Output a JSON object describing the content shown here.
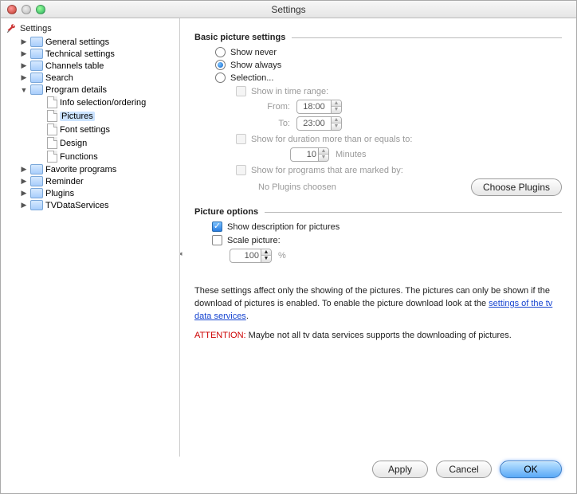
{
  "window": {
    "title": "Settings"
  },
  "sidebar": {
    "root": "Settings",
    "items": [
      {
        "label": "General settings",
        "expanded": false,
        "children": []
      },
      {
        "label": "Technical settings",
        "expanded": false,
        "children": []
      },
      {
        "label": "Channels table",
        "expanded": false,
        "children": []
      },
      {
        "label": "Search",
        "expanded": false,
        "children": []
      },
      {
        "label": "Program details",
        "expanded": true,
        "children": [
          {
            "label": "Info selection/ordering"
          },
          {
            "label": "Pictures",
            "selected": true
          },
          {
            "label": "Font settings"
          },
          {
            "label": "Design"
          },
          {
            "label": "Functions"
          }
        ]
      },
      {
        "label": "Favorite programs",
        "expanded": false,
        "children": []
      },
      {
        "label": "Reminder",
        "expanded": false,
        "children": []
      },
      {
        "label": "Plugins",
        "expanded": false,
        "children": []
      },
      {
        "label": "TVDataServices",
        "expanded": false,
        "children": []
      }
    ]
  },
  "sections": {
    "basic": {
      "heading": "Basic picture settings",
      "radios": {
        "never": "Show never",
        "always": "Show always",
        "selection": "Selection...",
        "selected": "always"
      },
      "timerange": {
        "label": "Show in time range:",
        "from_label": "From:",
        "from_value": "18:00",
        "to_label": "To:",
        "to_value": "23:00"
      },
      "duration": {
        "label": "Show for duration more than or equals to:",
        "value": "10",
        "unit": "Minutes"
      },
      "marked": {
        "label": "Show for programs that are marked by:",
        "none": "No Plugins choosen",
        "choose_btn": "Choose Plugins"
      }
    },
    "options": {
      "heading": "Picture options",
      "show_desc": "Show description for pictures",
      "scale_label": "Scale picture:",
      "scale_value": "100",
      "scale_unit": "%"
    },
    "note": {
      "text1": "These settings affect only the showing of the pictures. The pictures can only be shown if the download of pictures is enabled. To enable the picture download look at the ",
      "link": "settings of the tv data services",
      "text2": ".",
      "attn_label": "ATTENTION:",
      "attn_text": " Maybe not all tv data services supports the downloading of pictures."
    }
  },
  "footer": {
    "apply": "Apply",
    "cancel": "Cancel",
    "ok": "OK"
  }
}
